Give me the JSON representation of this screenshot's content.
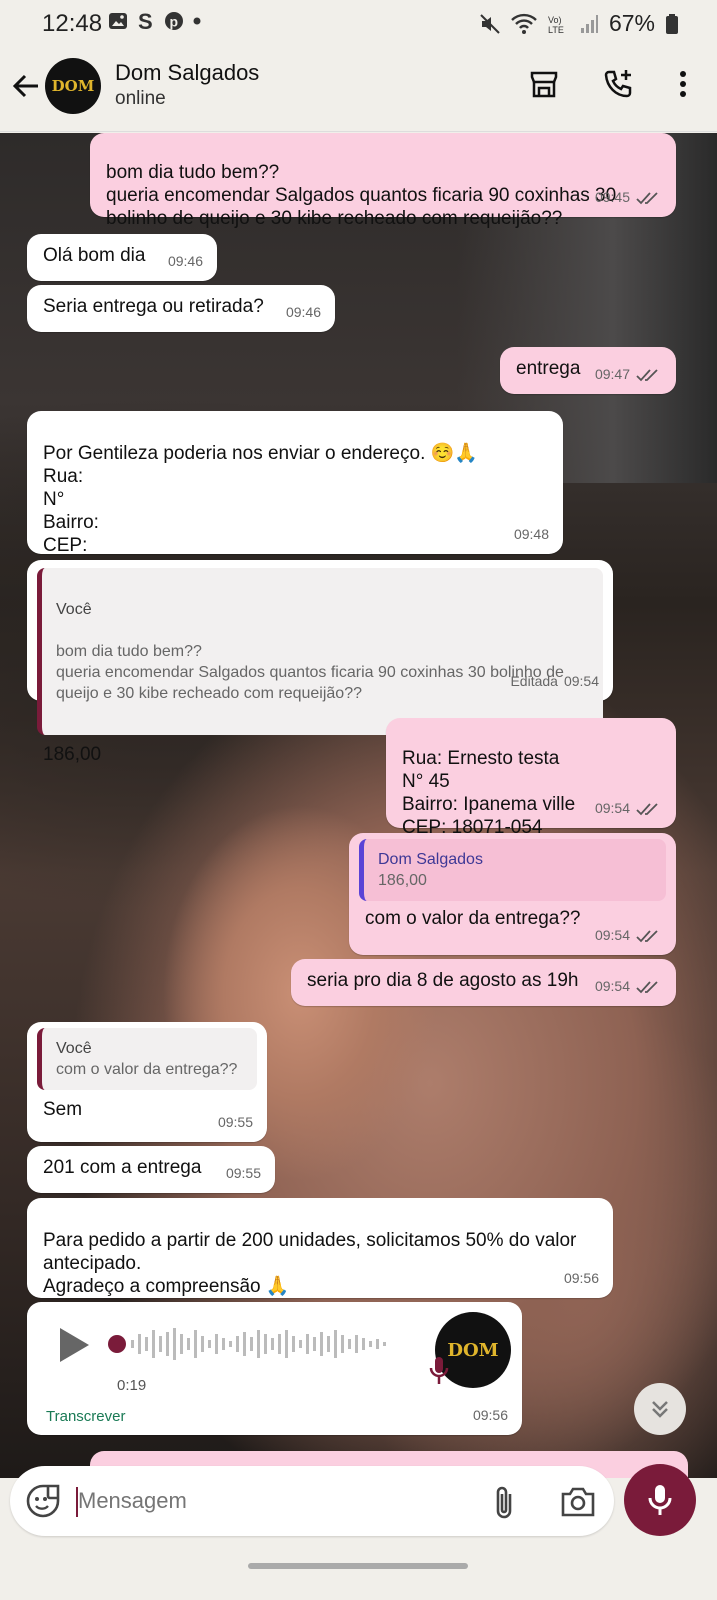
{
  "status_bar": {
    "time": "12:48",
    "battery": "67%",
    "icons": [
      "image-icon",
      "s-icon",
      "pinterest-icon",
      "dot-icon",
      "mute-icon",
      "wifi-icon",
      "volte-icon",
      "signal-icon",
      "battery-icon"
    ]
  },
  "header": {
    "contact_name": "Dom Salgados",
    "contact_status": "online",
    "avatar_text": "DOM"
  },
  "messages": [
    {
      "text": "bom dia tudo bem??\nqueria encomendar Salgados quantos ficaria 90 coxinhas 30 bolinho de queijo e 30 kibe recheado com requeijão??",
      "time": "09:45"
    },
    {
      "text": "Olá bom dia",
      "time": "09:46"
    },
    {
      "text": "Seria entrega ou retirada?",
      "time": "09:46"
    },
    {
      "text": "entrega",
      "time": "09:47"
    },
    {
      "text": "Por Gentileza poderia nos enviar o endereço. ☺️🙏\nRua:\nN°\nBairro:\nCEP:",
      "time": "09:48"
    },
    {
      "quote_author": "Você",
      "quote_text": "bom dia tudo bem??\nqueria encomendar Salgados quantos ficaria 90 coxinhas 30 bolinho de queijo e 30 kibe recheado com requeijão??",
      "text": "186,00",
      "edited": "Editada",
      "time": "09:54"
    },
    {
      "text": "Rua: Ernesto testa\nN° 45\nBairro: Ipanema ville\nCEP: 18071-054",
      "time": "09:54"
    },
    {
      "quote_author": "Dom Salgados",
      "quote_text": "186,00",
      "text": "com o valor da entrega??",
      "time": "09:54"
    },
    {
      "text": "seria pro dia 8 de agosto as 19h",
      "time": "09:54"
    },
    {
      "quote_author": "Você",
      "quote_text": "com o valor da entrega??",
      "text": "Sem",
      "time": "09:55"
    },
    {
      "text": "201 com a entrega",
      "time": "09:55"
    },
    {
      "text": "Para pedido a partir de 200 unidades, solicitamos 50% do valor antecipado.\nAgradeço a compreensão 🙏",
      "time": "09:56"
    },
    {
      "duration": "0:19",
      "transcribe": "Transcrever",
      "time": "09:56"
    }
  ],
  "composer": {
    "placeholder": "Mensagem"
  },
  "colors": {
    "outgoing": "#fbcfe0",
    "incoming": "#ffffff",
    "accent": "#7a1b3a"
  }
}
